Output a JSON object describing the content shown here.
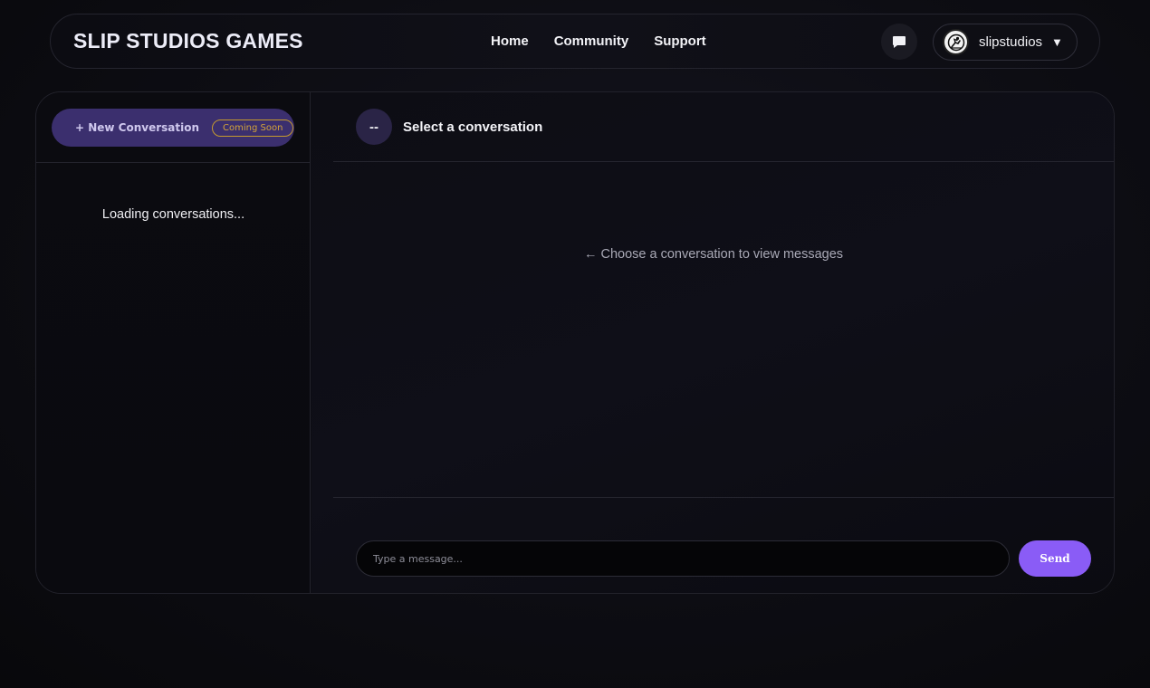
{
  "header": {
    "brand": "SLIP STUDIOS GAMES",
    "nav": [
      {
        "label": "Home"
      },
      {
        "label": "Community"
      },
      {
        "label": "Support"
      }
    ],
    "messages_icon": "chat-bubble-icon",
    "user": {
      "name": "slipstudios",
      "avatar_icon": "slip-logo-icon",
      "caret": "▼"
    }
  },
  "sidebar": {
    "new_conversation_label": "+ New Conversation",
    "badge": "Coming Soon",
    "loading_text": "Loading conversations..."
  },
  "chat": {
    "avatar_text": "--",
    "title": "Select a conversation",
    "placeholder_message": "← Choose a conversation to view messages",
    "input_placeholder": "Type a message...",
    "send_label": "Send"
  },
  "colors": {
    "accent": "#8a5cf6",
    "new_conv_bg": "#3b2f6e",
    "badge": "#c59a2f"
  }
}
